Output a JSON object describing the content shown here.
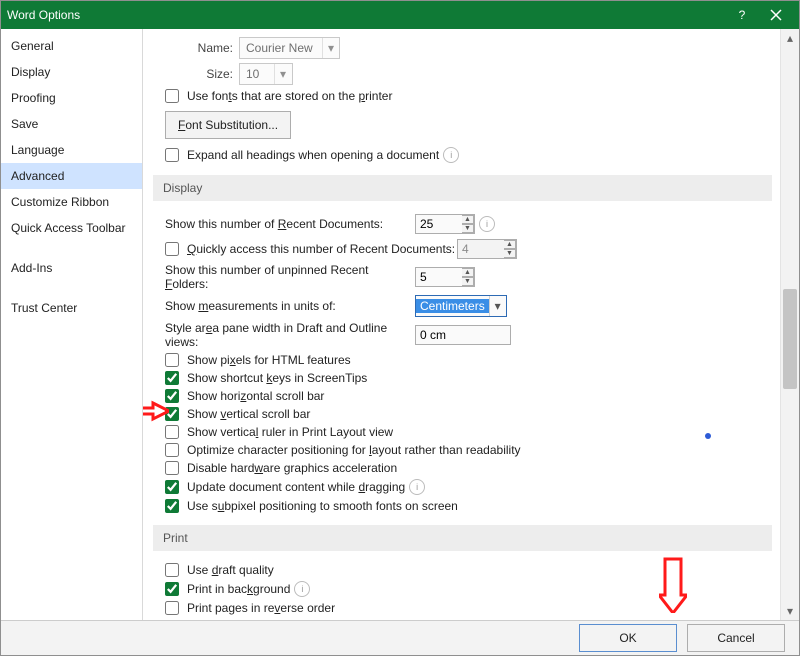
{
  "title": "Word Options",
  "sidebar": {
    "items": [
      {
        "label": "General"
      },
      {
        "label": "Display"
      },
      {
        "label": "Proofing"
      },
      {
        "label": "Save"
      },
      {
        "label": "Language"
      },
      {
        "label": "Advanced",
        "selected": true
      },
      {
        "label": "Customize Ribbon"
      },
      {
        "label": "Quick Access Toolbar"
      },
      {
        "label": "Add-Ins"
      },
      {
        "label": "Trust Center"
      }
    ]
  },
  "font_section": {
    "name_label": "Name:",
    "name_value": "Courier New",
    "size_label": "Size:",
    "size_value": "10",
    "use_printer_fonts": "Use fonts that are stored on the printer",
    "font_sub_btn": "Font Substitution...",
    "expand_headings": "Expand all headings when opening a document"
  },
  "display_section": {
    "header": "Display",
    "recent_docs_label": "Show this number of Recent Documents:",
    "recent_docs_value": "25",
    "quick_access": "Quickly access this number of Recent Documents:",
    "quick_access_value": "4",
    "unpinned_label": "Show this number of unpinned Recent Folders:",
    "unpinned_value": "5",
    "units_label": "Show measurements in units of:",
    "units_value": "Centimeters",
    "pane_width_label": "Style area pane width in Draft and Outline views:",
    "pane_width_value": "0 cm",
    "opts": [
      {
        "text": "Show pixels for HTML features",
        "checked": false
      },
      {
        "text": "Show shortcut keys in ScreenTips",
        "checked": true
      },
      {
        "text": "Show horizontal scroll bar",
        "checked": true
      },
      {
        "text": "Show vertical scroll bar",
        "checked": true
      },
      {
        "text": "Show vertical ruler in Print Layout view",
        "checked": false
      },
      {
        "text": "Optimize character positioning for layout rather than readability",
        "checked": false
      },
      {
        "text": "Disable hardware graphics acceleration",
        "checked": false
      },
      {
        "text": "Update document content while dragging",
        "checked": true,
        "info": true
      },
      {
        "text": "Use subpixel positioning to smooth fonts on screen",
        "checked": true
      }
    ]
  },
  "print_section": {
    "header": "Print",
    "opts": [
      {
        "text": "Use draft quality",
        "checked": false
      },
      {
        "text": "Print in background",
        "checked": true,
        "info": true
      },
      {
        "text": "Print pages in reverse order",
        "checked": false
      }
    ]
  },
  "footer": {
    "ok": "OK",
    "cancel": "Cancel"
  }
}
